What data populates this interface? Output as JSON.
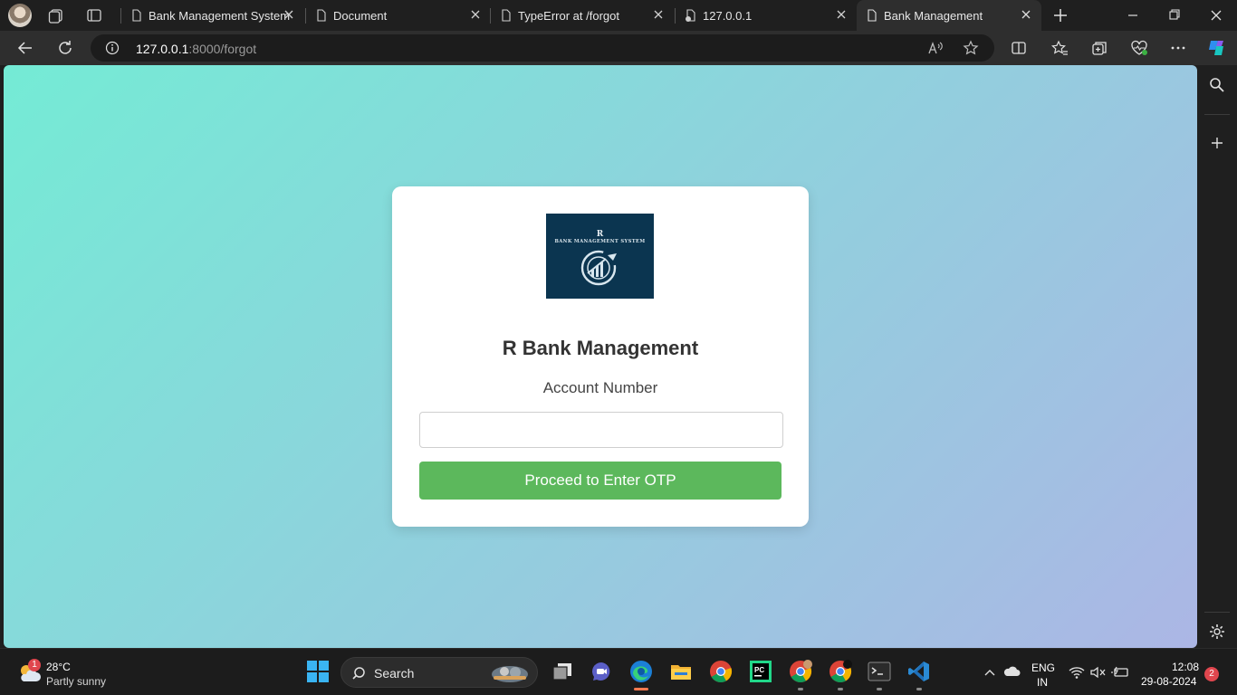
{
  "browser": {
    "tabs": [
      {
        "title": "Bank Management System",
        "icon": "page-icon",
        "active": false
      },
      {
        "title": "Document",
        "icon": "page-icon",
        "active": false
      },
      {
        "title": "TypeError at /forgot",
        "icon": "page-icon",
        "active": false
      },
      {
        "title": "127.0.0.1",
        "icon": "page-error-icon",
        "active": false
      },
      {
        "title": "Bank Management",
        "icon": "page-icon",
        "active": true
      }
    ],
    "address": {
      "host": "127.0.0.1",
      "rest": ":8000/forgot"
    }
  },
  "page": {
    "logo": {
      "letter": "R",
      "text": "BANK MANAGEMENT SYSTEM"
    },
    "title": "R Bank Management",
    "account_label": "Account Number",
    "account_value": "",
    "submit_label": "Proceed to Enter OTP",
    "colors": {
      "gradient_start": "#74ebd5",
      "gradient_end": "#acb6e5",
      "button": "#5cb85c",
      "logo_bg": "#0b3550"
    }
  },
  "taskbar": {
    "weather": {
      "temp": "28°C",
      "condition": "Partly sunny",
      "badge": "1"
    },
    "search_label": "Search",
    "language": {
      "line1": "ENG",
      "line2": "IN"
    },
    "clock": {
      "time": "12:08",
      "date": "29-08-2024"
    },
    "notifications": "2"
  }
}
